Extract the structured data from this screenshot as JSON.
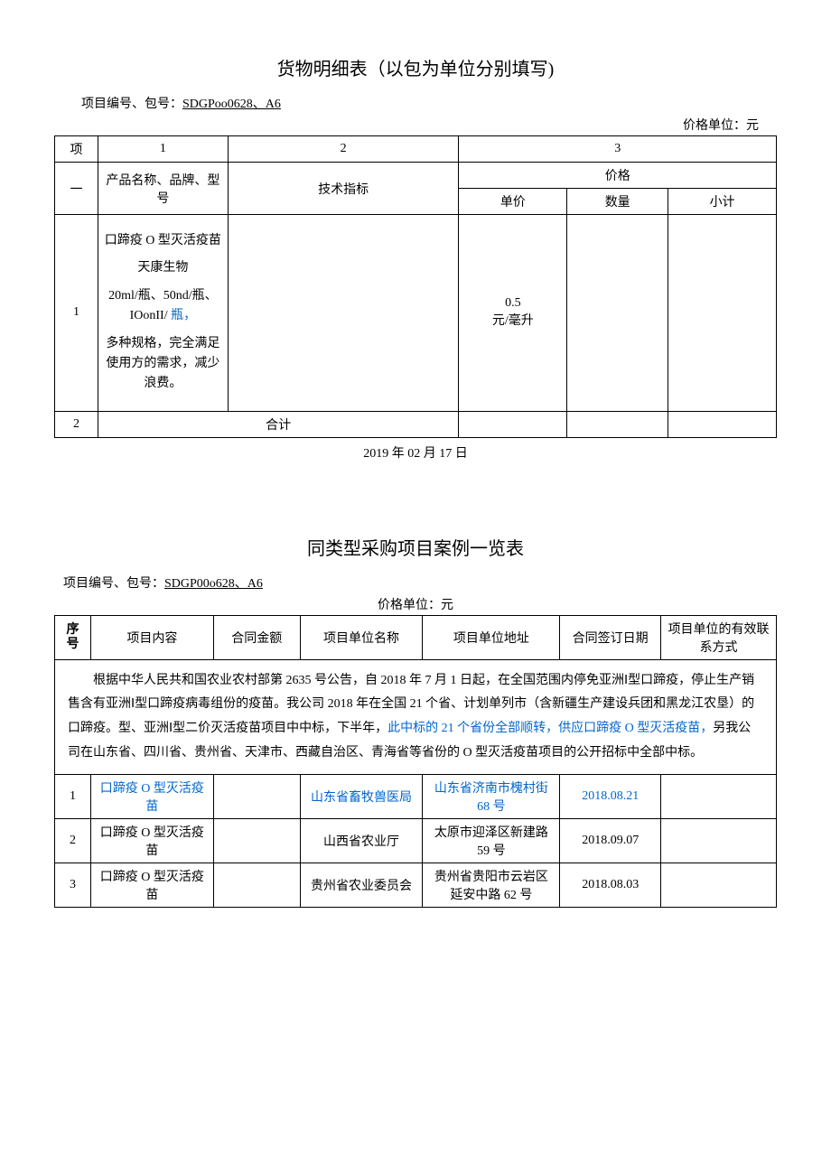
{
  "goods": {
    "title": "货物明细表（以包为单位分别填写)",
    "proj_label": "项目编号、包号：",
    "proj_code": "SDGPoo0628、A6",
    "unit_label": "价格单位：元",
    "cols": {
      "c0": "项",
      "c0b": "一",
      "c1": "1",
      "c2": "2",
      "c3": "3"
    },
    "header": {
      "name": "产品名称、品牌、型号",
      "spec": "技术指标",
      "price": "价格",
      "unit": "单价",
      "qty": "数量",
      "sub": "小计"
    },
    "row": {
      "no": "1",
      "line1": "口蹄疫 O 型灭活疫苗",
      "line2": "天康生物",
      "line3a": "20ml/瓶、50nd/瓶、IOonII/",
      "line3b": "瓶，",
      "line4": "多种规格，完全满足使用方的需求，减少浪费。",
      "unit_price": "0.5\n元/毫升"
    },
    "total_no": "2",
    "total_label": "合计",
    "date": "2019 年 02 月 17 日"
  },
  "cases": {
    "title": "同类型采购项目案例一览表",
    "proj_label": "项目编号、包号：",
    "proj_code": "SDGP00o628、A6",
    "unit_label": "价格单位：元",
    "header": {
      "seq": "序号",
      "content": "项目内容",
      "amount": "合同金额",
      "unit_name": "项目单位名称",
      "unit_addr": "项目单位地址",
      "sign_date": "合同签订日期",
      "contact": "项目单位的有效联系方式"
    },
    "note_a": "根据中华人民共和国农业农村部第 2635 号公告，自 2018 年 7 月 1 日起，在全国范围内停免亚洲Ⅰ型口蹄疫，停止生产销售含有亚洲Ⅰ型口蹄疫病毒组份的疫苗。我公司 2018 年在全国 21 个省、计划单列市（含新疆生产建设兵团和黑龙江农垦）的口蹄疫。型、亚洲Ⅰ型二价灭活疫苗项目中中标，下半年，",
    "note_b": "此中标的 21 个省份全部顺转，供应口蹄疫 O 型灭活疫苗，",
    "note_c": "另我公司在山东省、四川省、贵州省、天津市、西藏自治区、青海省等省份的 O 型灭活疫苗项目的公开招标中全部中标。",
    "rows": [
      {
        "no": "1",
        "content": "口蹄疫 O 型灭活疫苗",
        "amount": "",
        "unit_name": "山东省畜牧兽医局",
        "unit_addr": "山东省济南市槐村街 68 号",
        "sign_date": "2018.08.21",
        "contact": "",
        "blue": true
      },
      {
        "no": "2",
        "content": "口蹄疫 O 型灭活疫苗",
        "amount": "",
        "unit_name": "山西省农业厅",
        "unit_addr": "太原市迎泽区新建路 59 号",
        "sign_date": "2018.09.07",
        "contact": "",
        "blue": false
      },
      {
        "no": "3",
        "content": "口蹄疫 O 型灭活疫苗",
        "amount": "",
        "unit_name": "贵州省农业委员会",
        "unit_addr": "贵州省贵阳市云岩区延安中路 62 号",
        "sign_date": "2018.08.03",
        "contact": "",
        "blue": false
      }
    ]
  }
}
